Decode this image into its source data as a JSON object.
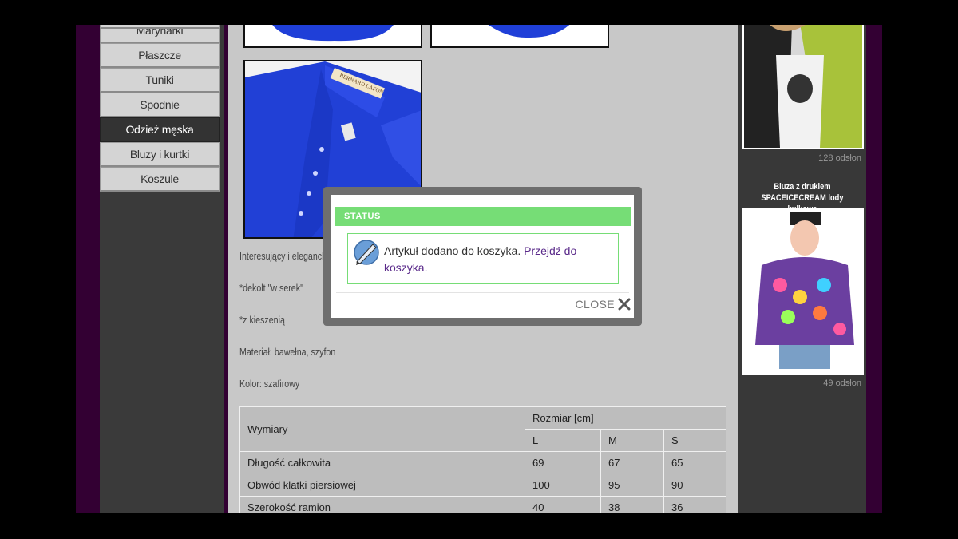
{
  "sidebar": {
    "categories": [
      "Marynarki",
      "Płaszcze",
      "Tuniki",
      "Spodnie",
      "Odzież męska",
      "Bluzy i kurtki",
      "Koszule"
    ],
    "active_index": 4
  },
  "product": {
    "image_label_text": "BERNARD LAFON",
    "description_lines": [
      "Interesujący i elegancki",
      "*dekolt \"w serek\"",
      "*z kieszenią",
      "Materiał: bawełna, szyfon",
      "Kolor: szafirowy"
    ],
    "size_table": {
      "col_header_main": "Wymiary",
      "col_header_group": "Rozmiar [cm]",
      "sizes": [
        "L",
        "M",
        "S"
      ],
      "rows": [
        {
          "label": "Długość całkowita",
          "values": [
            "69",
            "67",
            "65"
          ]
        },
        {
          "label": "Obwód klatki piersiowej",
          "values": [
            "100",
            "95",
            "90"
          ]
        },
        {
          "label": "Szerokość ramion",
          "values": [
            "40",
            "38",
            "36"
          ]
        }
      ]
    }
  },
  "right_column": {
    "item1_views": "128 odsłon",
    "item2_title": "Bluza z drukiem SPACEICECREAM lody kulkowe",
    "item2_views": "49 odsłon"
  },
  "modal": {
    "header": "STATUS",
    "message_prefix": "Artykuł dodano do koszyka.",
    "message_link": "Przejdź do koszyka.",
    "close_label": "CLOSE"
  },
  "colors": {
    "status_green": "#76dd76",
    "link_purple": "#5a2a8a",
    "page_purple": "#330033",
    "shirt_blue": "#1f3fd8"
  }
}
